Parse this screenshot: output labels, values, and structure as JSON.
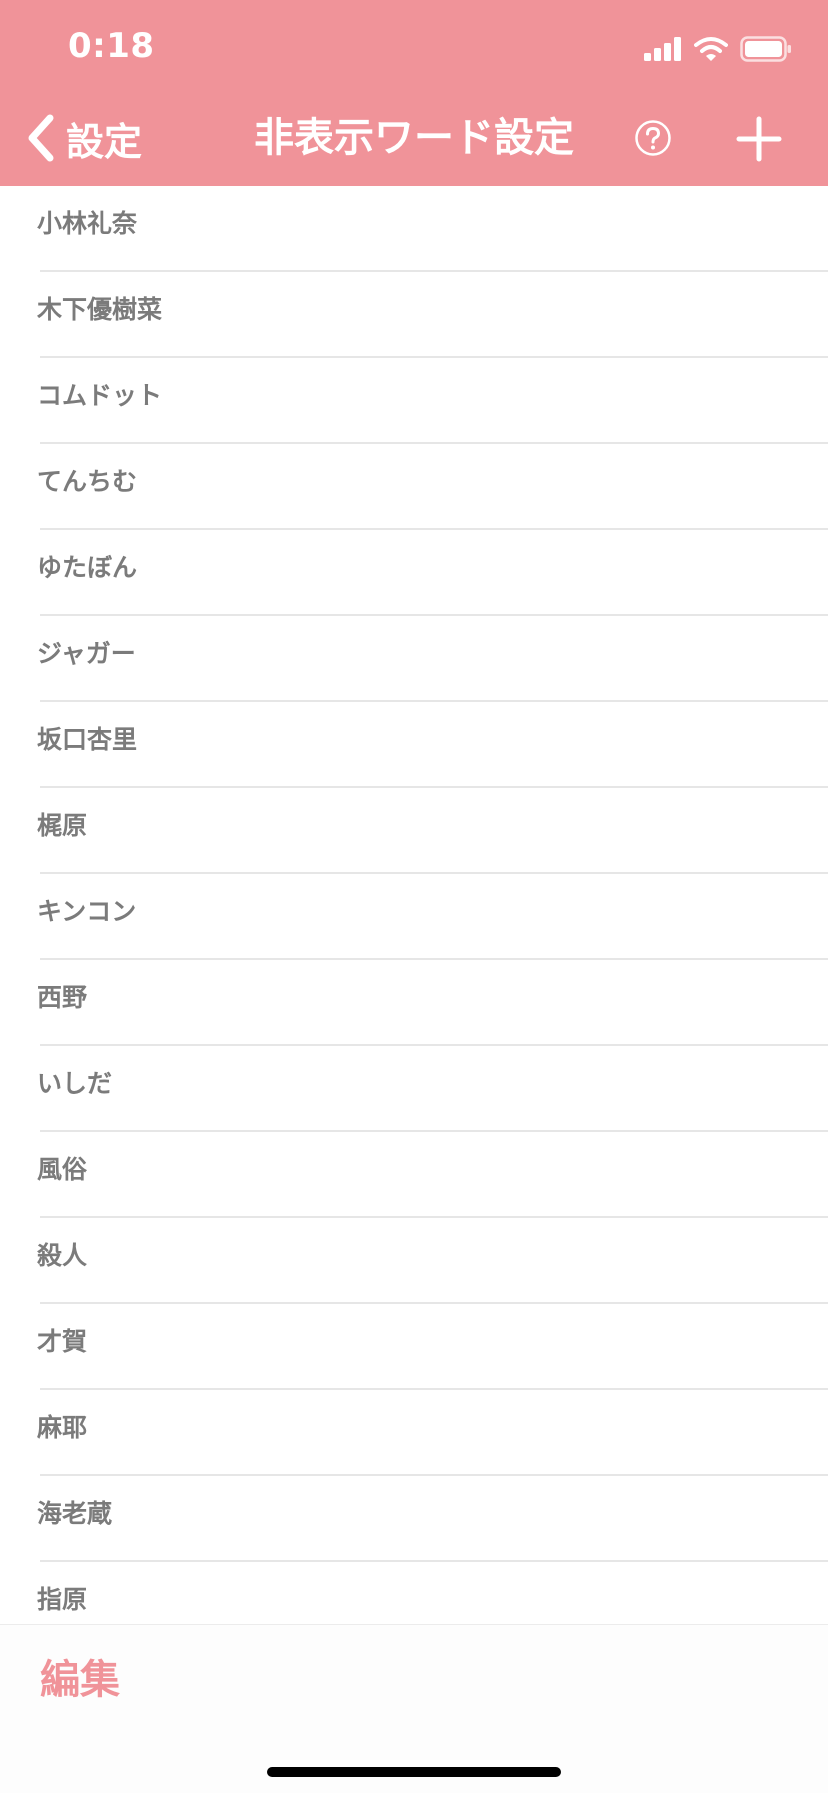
{
  "status_bar": {
    "time": "0:18"
  },
  "nav": {
    "back_label": "設定",
    "title": "非表示ワード設定",
    "help_icon": "question-circle-icon",
    "add_icon": "plus-icon"
  },
  "words": [
    "小林礼奈",
    "木下優樹菜",
    "コムドット",
    "てんちむ",
    "ゆたぼん",
    "ジャガー",
    "坂口杏里",
    "梶原",
    "キンコン",
    "西野",
    "いしだ",
    "風俗",
    "殺人",
    "才賀",
    "麻耶",
    "海老蔵",
    "指原"
  ],
  "toolbar": {
    "edit_label": "編集"
  },
  "colors": {
    "accent": "#f09399",
    "item_text": "#7b7b7b",
    "divider": "#e6e6e6"
  }
}
